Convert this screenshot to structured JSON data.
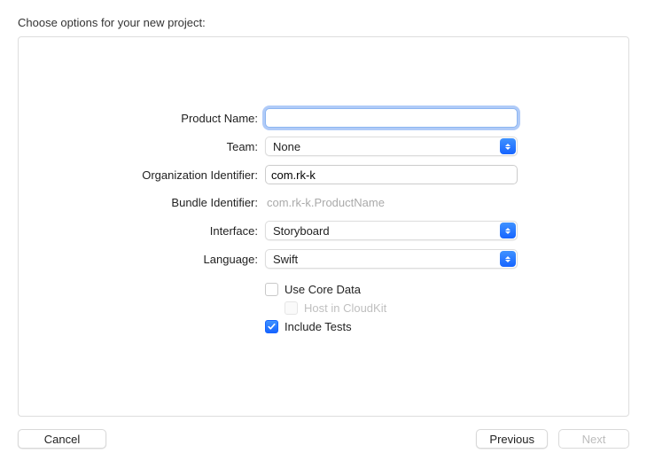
{
  "heading": "Choose options for your new project:",
  "form": {
    "productName": {
      "label": "Product Name:",
      "value": ""
    },
    "team": {
      "label": "Team:",
      "value": "None"
    },
    "orgId": {
      "label": "Organization Identifier:",
      "value": "com.rk-k"
    },
    "bundleId": {
      "label": "Bundle Identifier:",
      "value": "com.rk-k.ProductName"
    },
    "interface": {
      "label": "Interface:",
      "value": "Storyboard"
    },
    "language": {
      "label": "Language:",
      "value": "Swift"
    },
    "useCoreData": {
      "label": "Use Core Data",
      "checked": false
    },
    "hostCloudKit": {
      "label": "Host in CloudKit",
      "checked": false,
      "disabled": true
    },
    "includeTests": {
      "label": "Include Tests",
      "checked": true
    }
  },
  "buttons": {
    "cancel": "Cancel",
    "previous": "Previous",
    "next": "Next"
  },
  "colors": {
    "accent": "#1f72ff"
  }
}
